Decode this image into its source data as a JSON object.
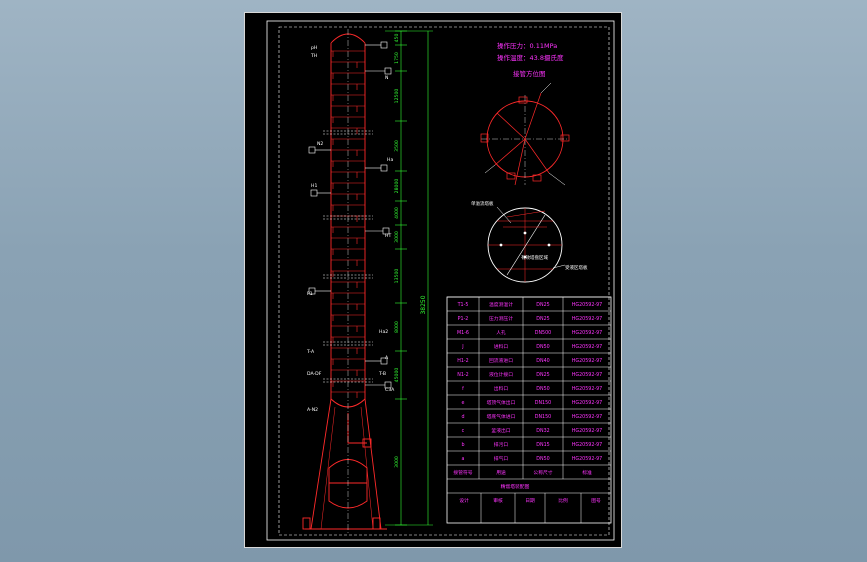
{
  "drawing": {
    "operating_pressure": "操作压力：0.11MPa",
    "operating_temperature": "操作温度：43.8摄氏度",
    "orientation_title": "接管方位图",
    "tray_labels": {
      "left": "单溢流塔板",
      "middle": "有效塔盘区域",
      "right": "受液区塔板"
    },
    "side_labels": [
      "pH",
      "TH",
      "N",
      "N2",
      "Ha",
      "H1",
      "HT",
      "P1",
      "A",
      "T-A",
      "T-B",
      "DA-DF",
      "C3A",
      "A-N2",
      "Ha2"
    ],
    "dimensions": [
      "450",
      "1750",
      "12500",
      "3500",
      "28000",
      "4000",
      "3000",
      "13500",
      "8000",
      "45000",
      "3000"
    ],
    "total_height": "38250"
  },
  "nozzle_table": {
    "rows": [
      {
        "symbol": "T1-5",
        "name": "温度测温计",
        "size": "DN25",
        "standard": "HG20592-97"
      },
      {
        "symbol": "P1-2",
        "name": "压力测压计",
        "size": "DN25",
        "standard": "HG20592-97"
      },
      {
        "symbol": "M1-6",
        "name": "人孔",
        "size": "DN500",
        "standard": "HG20592-97"
      },
      {
        "symbol": "J",
        "name": "进料口",
        "size": "DN50",
        "standard": "HG20592-97"
      },
      {
        "symbol": "H1-2",
        "name": "回流液进口",
        "size": "DN40",
        "standard": "HG20592-97"
      },
      {
        "symbol": "N1-2",
        "name": "液位计接口",
        "size": "DN25",
        "standard": "HG20592-97"
      },
      {
        "symbol": "f",
        "name": "出料口",
        "size": "DN50",
        "standard": "HG20592-97"
      },
      {
        "symbol": "e",
        "name": "塔顶气体出口",
        "size": "DN150",
        "standard": "HG20592-97"
      },
      {
        "symbol": "d",
        "name": "塔底气体进口",
        "size": "DN150",
        "standard": "HG20592-97"
      },
      {
        "symbol": "c",
        "name": "釜液出口",
        "size": "DN32",
        "standard": "HG20592-97"
      },
      {
        "symbol": "b",
        "name": "排污口",
        "size": "DN15",
        "standard": "HG20592-97"
      },
      {
        "symbol": "a",
        "name": "排气口",
        "size": "DN50",
        "standard": "HG20592-97"
      }
    ],
    "header": {
      "symbol": "接管符号",
      "name": "用途",
      "size": "公称尺寸",
      "standard": "标准"
    },
    "title_block": "精馏塔装配图",
    "footer": [
      "设计",
      "审核",
      "日期",
      "比例",
      "图号"
    ]
  }
}
